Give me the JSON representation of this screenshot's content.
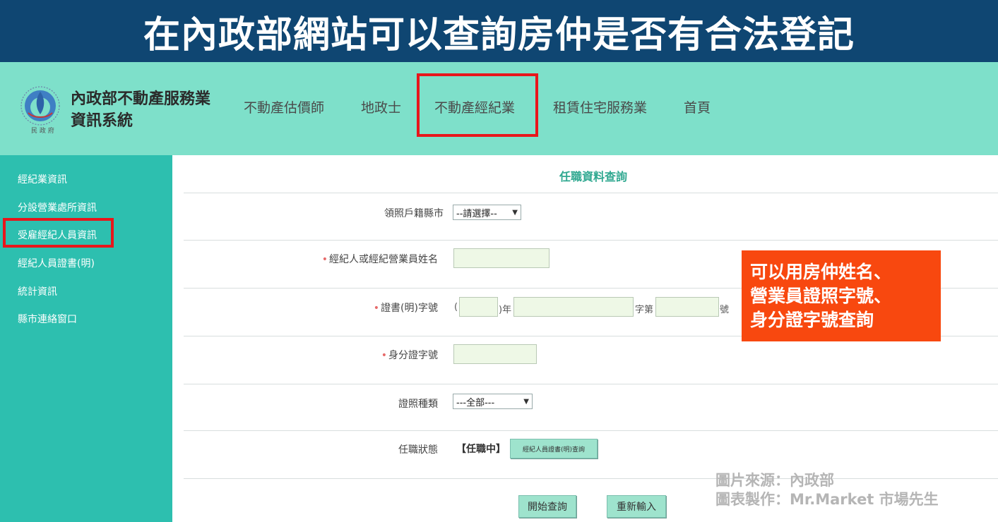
{
  "banner": {
    "title": "在內政部網站可以查詢房仲是否有合法登記"
  },
  "header": {
    "site_title": "內政部不動產服務業資訊系統",
    "nav": [
      {
        "label": "不動產估價師"
      },
      {
        "label": "地政士"
      },
      {
        "label": "不動產經紀業"
      },
      {
        "label": "租賃住宅服務業"
      },
      {
        "label": "首頁"
      }
    ]
  },
  "sidebar": {
    "items": [
      {
        "label": "經紀業資訊"
      },
      {
        "label": "分設營業處所資訊"
      },
      {
        "label": "受雇經紀人員資訊"
      },
      {
        "label": "經紀人員證書(明)"
      },
      {
        "label": "統計資訊"
      },
      {
        "label": "縣市連絡窗口"
      }
    ]
  },
  "form": {
    "title": "任職資料查詢",
    "city_label": "領照戶籍縣市",
    "city_value": "--請選擇--",
    "name_label": "經紀人或經紀營業員姓名",
    "cert_label": "證書(明)字號",
    "cert_paren": "(",
    "cert_year": ")年",
    "cert_zi": "字第",
    "cert_hao": "號",
    "id_label": "身分證字號",
    "type_label": "證照種類",
    "type_value": "---全部---",
    "status_label": "任職狀態",
    "status_value": "【任職中】",
    "cert_query_button": "經紀人員證書(明)查詢",
    "search_button": "開始查詢",
    "reset_button": "重新輸入"
  },
  "callout": {
    "lines": [
      "可以用房仲姓名、",
      "營業員證照字號、",
      "身分證字號查詢"
    ],
    "color": "#f8480f"
  },
  "credits": {
    "source": "圖片來源：內政部",
    "maker": "圖表製作：Mr.Market 市場先生"
  },
  "colors": {
    "banner": "#0f4672",
    "header": "#7ee0ca",
    "sidebar": "#2dbfaf",
    "highlight": "#e8161b"
  }
}
